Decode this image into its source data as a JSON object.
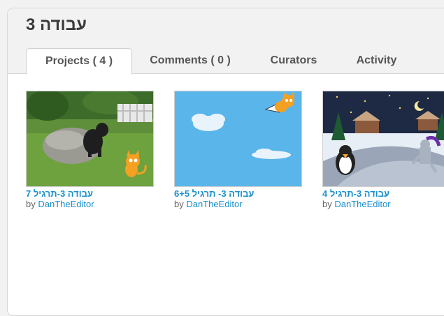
{
  "studio": {
    "title": "עבודה 3"
  },
  "tabs": [
    {
      "label": "Projects ( 4 )",
      "active": true
    },
    {
      "label": "Comments ( 0 )",
      "active": false
    },
    {
      "label": "Curators",
      "active": false
    },
    {
      "label": "Activity",
      "active": false
    }
  ],
  "projects": [
    {
      "title": "עבודה 3-תרגיל 7",
      "by": "by",
      "author": "DanTheEditor",
      "thumb": "dog-on-rock-garden"
    },
    {
      "title": "עבודה 3- תרגיל 6+5",
      "by": "by",
      "author": "DanTheEditor",
      "thumb": "flying-cat-sky"
    },
    {
      "title": "עבודה 3-תרגיל 4",
      "by": "by",
      "author": "DanTheEditor",
      "thumb": "winter-penguin-knight"
    }
  ],
  "colors": {
    "link": "#1a8fce",
    "title": "#3a3a3a",
    "tab_text": "#555555"
  }
}
